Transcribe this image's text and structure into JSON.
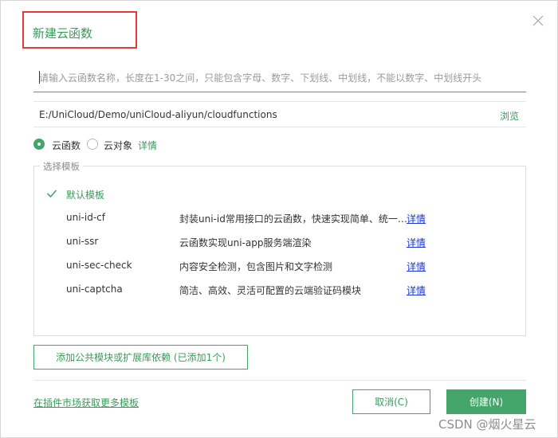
{
  "dialog": {
    "title": "新建云函数",
    "name_placeholder": "请输入云函数名称，长度在1-30之间，只能包含字母、数字、下划线、中划线，不能以数字、中划线开头",
    "path": "E:/UniCloud/Demo/uniCloud-aliyun/cloudfunctions",
    "browse_label": "浏览",
    "type_options": [
      {
        "label": "云函数",
        "checked": true
      },
      {
        "label": "云对象",
        "checked": false
      }
    ],
    "type_detail_label": "详情",
    "template_group_label": "选择模板",
    "templates": [
      {
        "name": "默认模板",
        "description": "",
        "detail": "",
        "selected": true
      },
      {
        "name": "uni-id-cf",
        "description": "封装uni-id常用接口的云函数，快速实现简单、统一…",
        "detail": "详情",
        "selected": false
      },
      {
        "name": "uni-ssr",
        "description": "云函数实现uni-app服务端渲染",
        "detail": "详情",
        "selected": false
      },
      {
        "name": "uni-sec-check",
        "description": "内容安全检测，包含图片和文字检测",
        "detail": "详情",
        "selected": false
      },
      {
        "name": "uni-captcha",
        "description": "简洁、高效、灵活可配置的云端验证码模块",
        "detail": "详情",
        "selected": false
      }
    ],
    "add_module_label": "添加公共模块或扩展库依赖 (已添加1个)",
    "market_link": "在插件市场获取更多模板",
    "cancel_label": "取消(C)",
    "create_label": "创建(N)"
  },
  "watermark": "CSDN @烟火星云",
  "colors": {
    "accent": "#44a56a",
    "accent_text": "#3a9b5a",
    "highlight_box": "#e53935",
    "detail_link": "#1a35d6"
  },
  "icons": {
    "close": "close-icon",
    "check": "check-icon"
  }
}
